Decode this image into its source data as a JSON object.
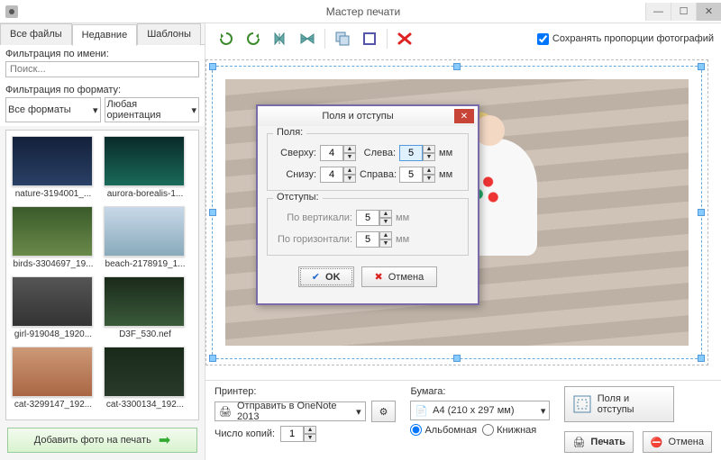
{
  "window": {
    "title": "Мастер печати"
  },
  "tabs": {
    "all": "Все файлы",
    "recent": "Недавние",
    "templates": "Шаблоны"
  },
  "filters": {
    "by_name_label": "Фильтрация по имени:",
    "search_placeholder": "Поиск...",
    "by_format_label": "Фильтрация по формату:",
    "format_value": "Все форматы",
    "orientation_value": "Любая ориентация"
  },
  "thumbnails": [
    {
      "caption": "nature-3194001_..."
    },
    {
      "caption": "aurora-borealis-1..."
    },
    {
      "caption": "birds-3304697_19..."
    },
    {
      "caption": "beach-2178919_1..."
    },
    {
      "caption": "girl-919048_1920..."
    },
    {
      "caption": "D3F_530.nef"
    },
    {
      "caption": "cat-3299147_192..."
    },
    {
      "caption": "cat-3300134_192..."
    }
  ],
  "add_button": "Добавить фото на печать",
  "keep_proportions": "Сохранять пропорции фотографий",
  "dialog": {
    "title": "Поля и отступы",
    "fields_group": "Поля:",
    "top_label": "Сверху:",
    "top_value": "4",
    "bottom_label": "Снизу:",
    "bottom_value": "4",
    "left_label": "Слева:",
    "left_value": "5",
    "right_label": "Справа:",
    "right_value": "5",
    "unit": "мм",
    "gaps_group": "Отступы:",
    "vgap_label": "По вертикали:",
    "vgap_value": "5",
    "hgap_label": "По горизонтали:",
    "hgap_value": "5",
    "ok": "OK",
    "cancel": "Отмена"
  },
  "bottom": {
    "printer_label": "Принтер:",
    "printer_value": "Отправить в OneNote 2013",
    "copies_label": "Число копий:",
    "copies_value": "1",
    "paper_label": "Бумага:",
    "paper_value": "А4 (210 x 297 мм)",
    "landscape": "Альбомная",
    "portrait": "Книжная",
    "margins_button": "Поля и отступы",
    "print": "Печать",
    "cancel": "Отмена"
  }
}
